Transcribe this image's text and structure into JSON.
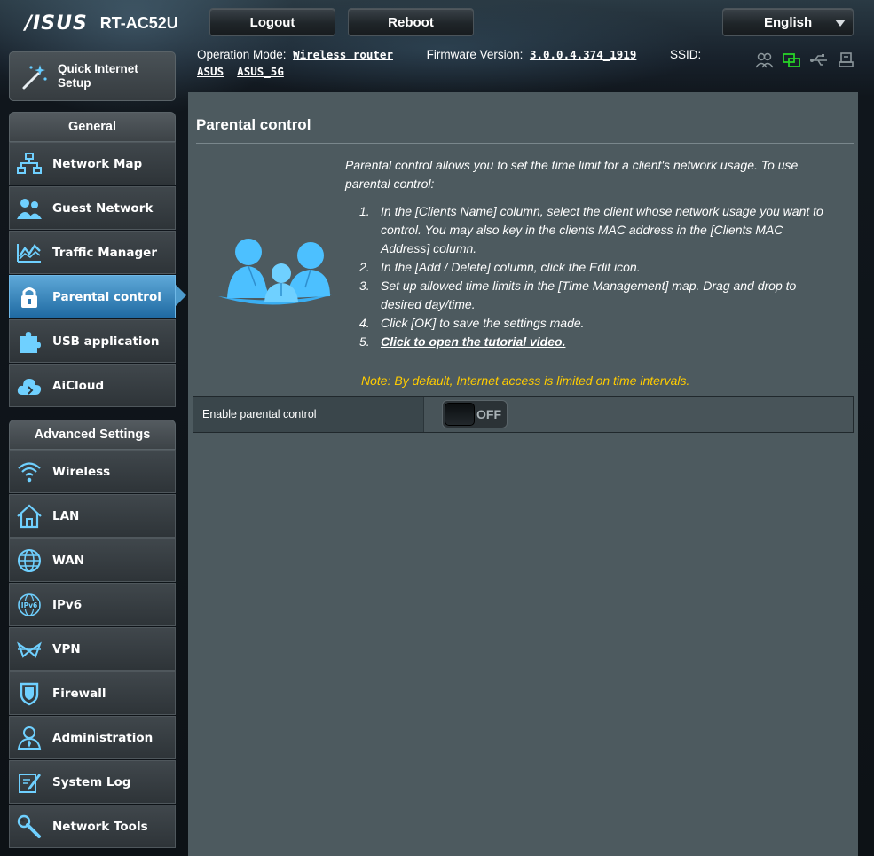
{
  "header": {
    "brand": "/ISUS",
    "model": "RT-AC52U",
    "logout_label": "Logout",
    "reboot_label": "Reboot",
    "language": "English"
  },
  "status": {
    "operation_mode_label": "Operation Mode:",
    "operation_mode_value": "Wireless router",
    "firmware_label": "Firmware Version:",
    "firmware_value": "3.0.0.4.374_1919",
    "ssid_label": "SSID:",
    "ssid_1": "ASUS",
    "ssid_2": "ASUS_5G",
    "icons": [
      "clients-icon",
      "network-status-icon",
      "usb-icon",
      "printer-icon"
    ],
    "active_color": "#27d327"
  },
  "sidebar": {
    "quick_setup": "Quick Internet Setup",
    "general_header": "General",
    "general_items": [
      {
        "label": "Network Map",
        "icon": "network-map-icon"
      },
      {
        "label": "Guest Network",
        "icon": "guest-network-icon"
      },
      {
        "label": "Traffic Manager",
        "icon": "traffic-manager-icon"
      },
      {
        "label": "Parental control",
        "icon": "lock-icon",
        "active": true
      },
      {
        "label": "USB application",
        "icon": "puzzle-icon"
      },
      {
        "label": "AiCloud",
        "icon": "cloud-icon"
      }
    ],
    "advanced_header": "Advanced Settings",
    "advanced_items": [
      {
        "label": "Wireless",
        "icon": "wifi-icon"
      },
      {
        "label": "LAN",
        "icon": "home-icon"
      },
      {
        "label": "WAN",
        "icon": "globe-icon"
      },
      {
        "label": "IPv6",
        "icon": "ipv6-icon"
      },
      {
        "label": "VPN",
        "icon": "vpn-icon"
      },
      {
        "label": "Firewall",
        "icon": "shield-icon"
      },
      {
        "label": "Administration",
        "icon": "admin-icon"
      },
      {
        "label": "System Log",
        "icon": "log-icon"
      },
      {
        "label": "Network Tools",
        "icon": "tools-icon"
      }
    ]
  },
  "main": {
    "title": "Parental control",
    "intro": "Parental control allows you to set the time limit for a client's network usage. To use parental control:",
    "steps": [
      {
        "num": "1.",
        "text": "In the [Clients Name] column, select the client whose network usage you want to control. You may also key in the clients MAC address in the [Clients MAC Address] column."
      },
      {
        "num": "2.",
        "text": "In the [Add / Delete] column, click the Edit icon."
      },
      {
        "num": "3.",
        "text": "Set up allowed time limits in the [Time Management] map. Drag and drop to desired day/time."
      },
      {
        "num": "4.",
        "text": "Click [OK] to save the settings made."
      },
      {
        "num": "5.",
        "text": "Click to open the tutorial video."
      }
    ],
    "note": "Note: By default, Internet access is limited on time intervals.",
    "setting_label": "Enable parental control",
    "toggle_state": "OFF"
  }
}
